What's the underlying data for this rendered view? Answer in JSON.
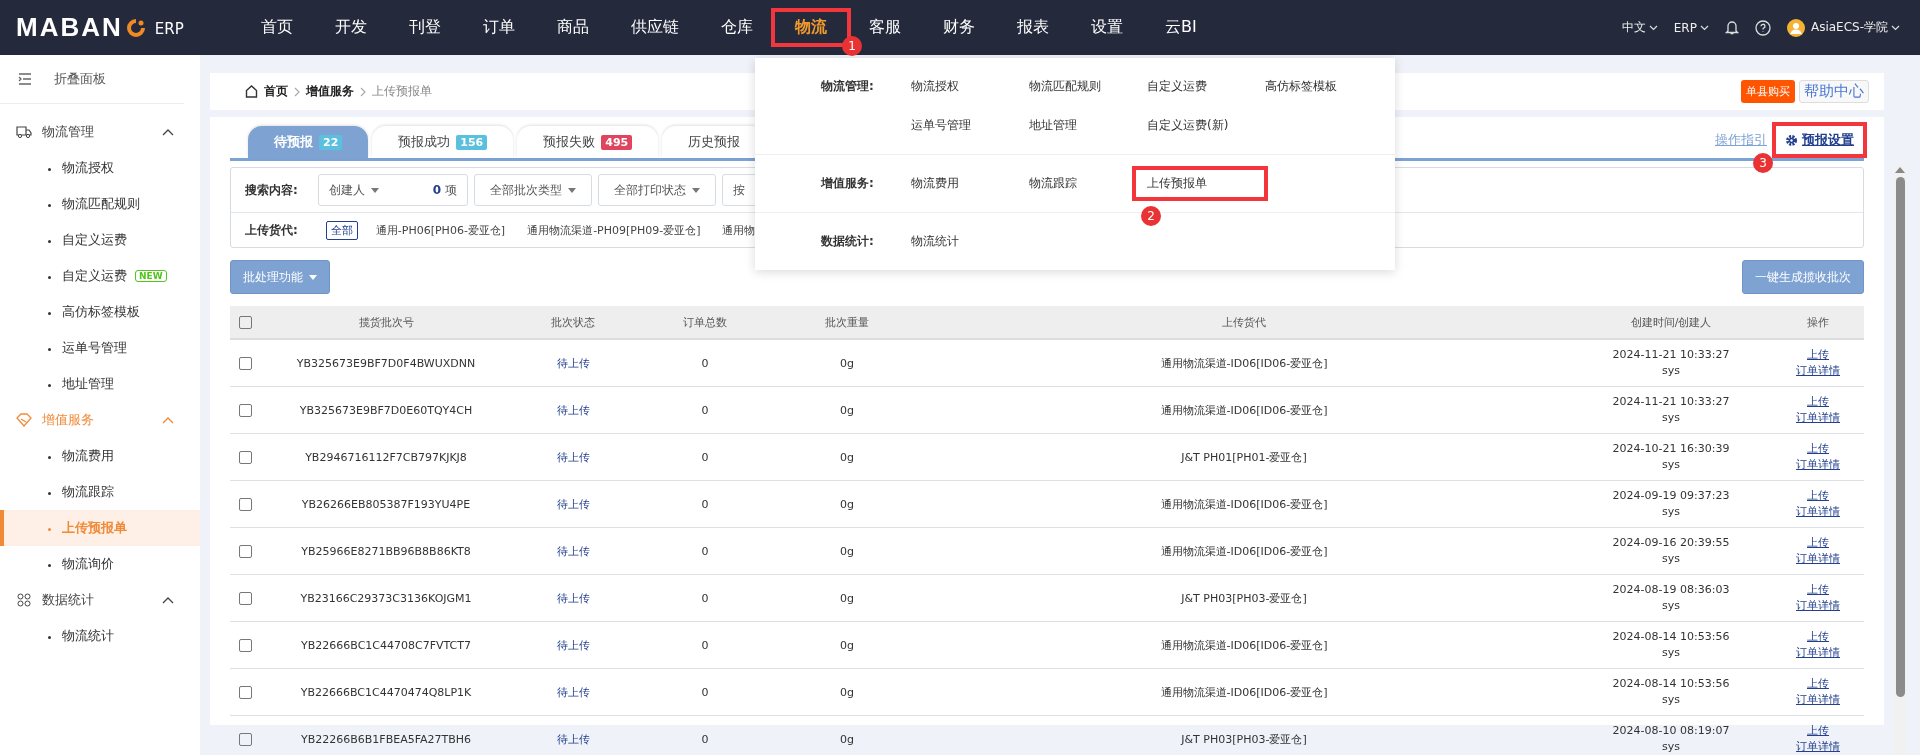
{
  "top_nav": {
    "logo": "MABAN",
    "logo_suffix": "ERP",
    "items": [
      {
        "label": "首页",
        "selected": false
      },
      {
        "label": "开发",
        "selected": false
      },
      {
        "label": "刊登",
        "selected": false
      },
      {
        "label": "订单",
        "selected": false
      },
      {
        "label": "商品",
        "selected": false
      },
      {
        "label": "供应链",
        "selected": false
      },
      {
        "label": "仓库",
        "selected": false
      },
      {
        "label": "物流",
        "selected": true,
        "callout": "1"
      },
      {
        "label": "客服",
        "selected": false
      },
      {
        "label": "财务",
        "selected": false
      },
      {
        "label": "报表",
        "selected": false
      },
      {
        "label": "设置",
        "selected": false
      },
      {
        "label": "云BI",
        "selected": false
      }
    ],
    "language": "中文",
    "product": "ERP",
    "user": "AsiaECS-学院"
  },
  "sidebar": {
    "collapse": "折叠面板",
    "groups": [
      {
        "label": "物流管理",
        "expanded": true,
        "selected": false,
        "children": [
          {
            "label": "物流授权",
            "selected": false
          },
          {
            "label": "物流匹配规则",
            "selected": false
          },
          {
            "label": "自定义运费",
            "selected": false
          },
          {
            "label": "自定义运费",
            "badge": "NEW",
            "selected": false
          },
          {
            "label": "高仿标签模板",
            "selected": false
          },
          {
            "label": "运单号管理",
            "selected": false
          },
          {
            "label": "地址管理",
            "selected": false
          }
        ]
      },
      {
        "label": "增值服务",
        "expanded": true,
        "selected": true,
        "children": [
          {
            "label": "物流费用",
            "selected": false
          },
          {
            "label": "物流跟踪",
            "selected": false
          },
          {
            "label": "上传预报单",
            "selected": true
          },
          {
            "label": "物流询价",
            "selected": false
          }
        ]
      },
      {
        "label": "数据统计",
        "expanded": true,
        "selected": false,
        "children": [
          {
            "label": "物流统计",
            "selected": false
          }
        ]
      }
    ]
  },
  "breadcrumb": [
    "首页",
    "增值服务",
    "上传预报单"
  ],
  "header_buttons": {
    "buy": "单县购买",
    "help": "帮助中心"
  },
  "tabs": [
    {
      "label": "待预报",
      "count": "22",
      "color": "#5bc0de",
      "selected": true
    },
    {
      "label": "预报成功",
      "count": "156",
      "color": "#5bc0de",
      "selected": false
    },
    {
      "label": "预报失败",
      "count": "495",
      "color": "#e0455f",
      "selected": false
    },
    {
      "label": "历史预报",
      "selected": false
    }
  ],
  "guide_link": "操作指引",
  "settings_link": {
    "label": "预报设置",
    "callout": "3"
  },
  "search": {
    "label": "搜索内容:",
    "filters": [
      {
        "label": "创建人",
        "count": "0",
        "unit": "项"
      },
      {
        "label": "全部批次类型"
      },
      {
        "label": "全部打印状态"
      },
      {
        "label": "按"
      }
    ],
    "carrier_label": "上传货代:",
    "carriers": [
      {
        "label": "全部",
        "selected": true
      },
      {
        "label": "通用-PH06[PH06-爱亚仓]",
        "selected": false
      },
      {
        "label": "通用物流渠道-PH09[PH09-爱亚仓]",
        "selected": false
      },
      {
        "label": "通用物",
        "selected": false
      }
    ]
  },
  "batch_button": "批处理功能",
  "generate_button": "一键生成揽收批次",
  "table": {
    "select_all_checked": false,
    "columns": [
      "揽货批次号",
      "批次状态",
      "订单总数",
      "批次重量",
      "上传货代",
      "创建时间/创建人",
      "操作"
    ],
    "rows": [
      {
        "batch": "YB325673E9BF7D0F4BWUXDNN",
        "status": "待上传",
        "orders": "0",
        "weight": "0g",
        "carrier": "通用物流渠道-ID06[ID06-爱亚仓]",
        "time": "2024-11-21 10:33:27",
        "user": "sys",
        "actions": [
          "上传",
          "订单详情"
        ],
        "checked": false
      },
      {
        "batch": "YB325673E9BF7D0E60TQY4CH",
        "status": "待上传",
        "orders": "0",
        "weight": "0g",
        "carrier": "通用物流渠道-ID06[ID06-爱亚仓]",
        "time": "2024-11-21 10:33:27",
        "user": "sys",
        "actions": [
          "上传",
          "订单详情"
        ],
        "checked": false
      },
      {
        "batch": "YB2946716112F7CB797KJKJ8",
        "status": "待上传",
        "orders": "0",
        "weight": "0g",
        "carrier": "J&T PH01[PH01-爱亚仓]",
        "time": "2024-10-21 16:30:39",
        "user": "sys",
        "actions": [
          "上传",
          "订单详情"
        ],
        "checked": false
      },
      {
        "batch": "YB26266EB805387F193YU4PE",
        "status": "待上传",
        "orders": "0",
        "weight": "0g",
        "carrier": "通用物流渠道-ID06[ID06-爱亚仓]",
        "time": "2024-09-19 09:37:23",
        "user": "sys",
        "actions": [
          "上传",
          "订单详情"
        ],
        "checked": false
      },
      {
        "batch": "YB25966E8271BB96B8B86KT8",
        "status": "待上传",
        "orders": "0",
        "weight": "0g",
        "carrier": "通用物流渠道-ID06[ID06-爱亚仓]",
        "time": "2024-09-16 20:39:55",
        "user": "sys",
        "actions": [
          "上传",
          "订单详情"
        ],
        "checked": false
      },
      {
        "batch": "YB23166C29373C3136KOJGM1",
        "status": "待上传",
        "orders": "0",
        "weight": "0g",
        "carrier": "J&T PH03[PH03-爱亚仓]",
        "time": "2024-08-19 08:36:03",
        "user": "sys",
        "actions": [
          "上传",
          "订单详情"
        ],
        "checked": false
      },
      {
        "batch": "YB22666BC1C44708C7FVTCT7",
        "status": "待上传",
        "orders": "0",
        "weight": "0g",
        "carrier": "通用物流渠道-ID06[ID06-爱亚仓]",
        "time": "2024-08-14 10:53:56",
        "user": "sys",
        "actions": [
          "上传",
          "订单详情"
        ],
        "checked": false
      },
      {
        "batch": "YB22666BC1C4470474Q8LP1K",
        "status": "待上传",
        "orders": "0",
        "weight": "0g",
        "carrier": "通用物流渠道-ID06[ID06-爱亚仓]",
        "time": "2024-08-14 10:53:56",
        "user": "sys",
        "actions": [
          "上传",
          "订单详情"
        ],
        "checked": false
      },
      {
        "batch": "YB22266B6B1FBEA5FA27TBH6",
        "status": "待上传",
        "orders": "0",
        "weight": "0g",
        "carrier": "J&T PH03[PH03-爱亚仓]",
        "time": "2024-08-10 08:19:07",
        "user": "sys",
        "actions": [
          "上传",
          "订单详情"
        ],
        "checked": false
      }
    ]
  },
  "mega_menu": {
    "sections": [
      {
        "label": "物流管理:",
        "items": [
          {
            "label": "物流授权"
          },
          {
            "label": "物流匹配规则"
          },
          {
            "label": "自定义运费"
          },
          {
            "label": "高仿标签模板"
          },
          {
            "label": "运单号管理"
          },
          {
            "label": "地址管理"
          },
          {
            "label": "自定义运费(新)"
          }
        ]
      },
      {
        "label": "增值服务:",
        "items": [
          {
            "label": "物流费用"
          },
          {
            "label": "物流跟踪"
          },
          {
            "label": "上传预报单",
            "callout": "2"
          }
        ]
      },
      {
        "label": "数据统计:",
        "items": [
          {
            "label": "物流统计"
          }
        ]
      }
    ]
  }
}
